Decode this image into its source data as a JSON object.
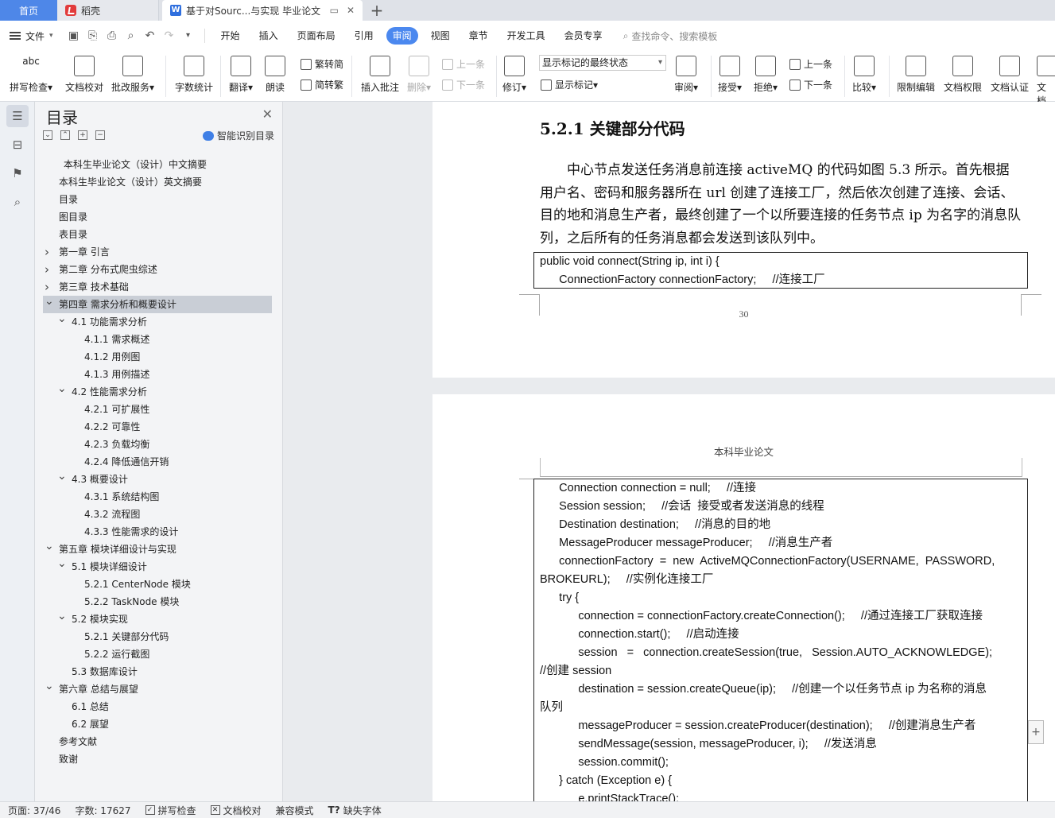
{
  "tabs": {
    "home": "首页",
    "docer": "稻壳",
    "active_doc": "基于对Sourc...与实现 毕业论文",
    "new_tab": "+"
  },
  "menu": {
    "file": "文件",
    "items": [
      "开始",
      "插入",
      "页面布局",
      "引用",
      "审阅",
      "视图",
      "章节",
      "开发工具",
      "会员专享"
    ],
    "active": "审阅",
    "search_placeholder": "查找命令、搜索模板"
  },
  "ribbon": {
    "spell": "拼写检查",
    "proofread": "文档校对",
    "correction": "批改服务",
    "wordcount": "字数统计",
    "translate": "翻译",
    "read": "朗读",
    "trad": "繁转简",
    "simp": "简转繁",
    "insert_comment": "插入批注",
    "delete": "删除",
    "prev_comment": "上一条",
    "next_comment": "下一条",
    "revise": "修订",
    "markup_state": "显示标记的最终状态",
    "show_markup": "显示标记",
    "review": "审阅",
    "accept": "接受",
    "reject": "拒绝",
    "prev_change": "上一条",
    "next_change": "下一条",
    "compare": "比较",
    "restrict": "限制编辑",
    "permission": "文档权限",
    "certify": "文档认证",
    "more": "文档"
  },
  "toc": {
    "title": "目录",
    "smart": "智能识别目录",
    "items": [
      {
        "label": "本科生毕业论文（设计）中文摘要",
        "level": 0,
        "arrow": ""
      },
      {
        "label": "本科生毕业论文（设计）英文摘要",
        "level": 0,
        "arrow": ""
      },
      {
        "label": "目录",
        "level": 0,
        "arrow": ""
      },
      {
        "label": "图目录",
        "level": 0,
        "arrow": ""
      },
      {
        "label": "表目录",
        "level": 0,
        "arrow": ""
      },
      {
        "label": "第一章  引言",
        "level": 0,
        "arrow": ">"
      },
      {
        "label": "第二章  分布式爬虫综述",
        "level": 0,
        "arrow": ">"
      },
      {
        "label": "第三章  技术基础",
        "level": 0,
        "arrow": ">"
      },
      {
        "label": "第四章  需求分析和概要设计",
        "level": 0,
        "arrow": "v",
        "selected": true
      },
      {
        "label": "4.1  功能需求分析",
        "level": 1,
        "arrow": "v"
      },
      {
        "label": "4.1.1  需求概述",
        "level": 2,
        "arrow": ""
      },
      {
        "label": "4.1.2  用例图",
        "level": 2,
        "arrow": ""
      },
      {
        "label": "4.1.3  用例描述",
        "level": 2,
        "arrow": ""
      },
      {
        "label": "4.2  性能需求分析",
        "level": 1,
        "arrow": "v"
      },
      {
        "label": "4.2.1  可扩展性",
        "level": 2,
        "arrow": ""
      },
      {
        "label": "4.2.2  可靠性",
        "level": 2,
        "arrow": ""
      },
      {
        "label": "4.2.3  负载均衡",
        "level": 2,
        "arrow": ""
      },
      {
        "label": "4.2.4  降低通信开销",
        "level": 2,
        "arrow": ""
      },
      {
        "label": "4.3  概要设计",
        "level": 1,
        "arrow": "v"
      },
      {
        "label": "4.3.1  系统结构图",
        "level": 2,
        "arrow": ""
      },
      {
        "label": "4.3.2  流程图",
        "level": 2,
        "arrow": ""
      },
      {
        "label": "4.3.3  性能需求的设计",
        "level": 2,
        "arrow": ""
      },
      {
        "label": "第五章  模块详细设计与实现",
        "level": 0,
        "arrow": "v"
      },
      {
        "label": "5.1  模块详细设计",
        "level": 1,
        "arrow": "v"
      },
      {
        "label": "5.2.1 CenterNode 模块",
        "level": 2,
        "arrow": ""
      },
      {
        "label": "5.2.2 TaskNode 模块",
        "level": 2,
        "arrow": ""
      },
      {
        "label": "5.2  模块实现",
        "level": 1,
        "arrow": "v"
      },
      {
        "label": "5.2.1  关键部分代码",
        "level": 2,
        "arrow": ""
      },
      {
        "label": "5.2.2  运行截图",
        "level": 2,
        "arrow": ""
      },
      {
        "label": "5.3  数据库设计",
        "level": 1,
        "arrow": ""
      },
      {
        "label": "第六章  总结与展望",
        "level": 0,
        "arrow": "v"
      },
      {
        "label": "6.1  总结",
        "level": 1,
        "arrow": ""
      },
      {
        "label": "6.2  展望",
        "level": 1,
        "arrow": ""
      },
      {
        "label": "参考文献",
        "level": 0,
        "arrow": ""
      },
      {
        "label": "致谢",
        "level": 0,
        "arrow": ""
      }
    ]
  },
  "doc": {
    "section_heading": "5.2.1  关键部分代码",
    "paragraph": "中心节点发送任务消息前连接 activeMQ 的代码如图 5.3 所示。首先根据用户名、密码和服务器所在 url 创建了连接工厂，然后依次创建了连接、会话、目的地和消息生产者，最终创建了一个以所要连接的任务节点 ip 为名字的消息队列，之后所有的任务消息都会发送到该队列中。",
    "code1": [
      "public void connect(String ip, int i) {",
      "      ConnectionFactory connectionFactory;     //连接工厂"
    ],
    "page_number": "30",
    "page2_header": "本科毕业论文",
    "code2": [
      "      Connection connection = null;     //连接",
      "      Session session;     //会话  接受或者发送消息的线程",
      "      Destination destination;     //消息的目的地",
      "      MessageProducer messageProducer;     //消息生产者",
      "      connectionFactory  =  new  ActiveMQConnectionFactory(USERNAME,  PASSWORD,",
      "BROKEURL);     //实例化连接工厂",
      "      try {",
      "            connection = connectionFactory.createConnection();     //通过连接工厂获取连接",
      "            connection.start();     //启动连接",
      "            session   =   connection.createSession(true,   Session.AUTO_ACKNOWLEDGE);",
      "//创建 session",
      "            destination = session.createQueue(ip);     //创建一个以任务节点 ip 为名称的消息",
      "队列",
      "            messageProducer = session.createProducer(destination);     //创建消息生产者",
      "            sendMessage(session, messageProducer, i);     //发送消息",
      "            session.commit();",
      "      } catch (Exception e) {",
      "            e.printStackTrace();"
    ]
  },
  "status": {
    "page": "页面: 37/46",
    "words": "字数: 17627",
    "spell": "拼写检查",
    "proof": "文档校对",
    "compat": "兼容模式",
    "font_missing": "缺失字体"
  }
}
